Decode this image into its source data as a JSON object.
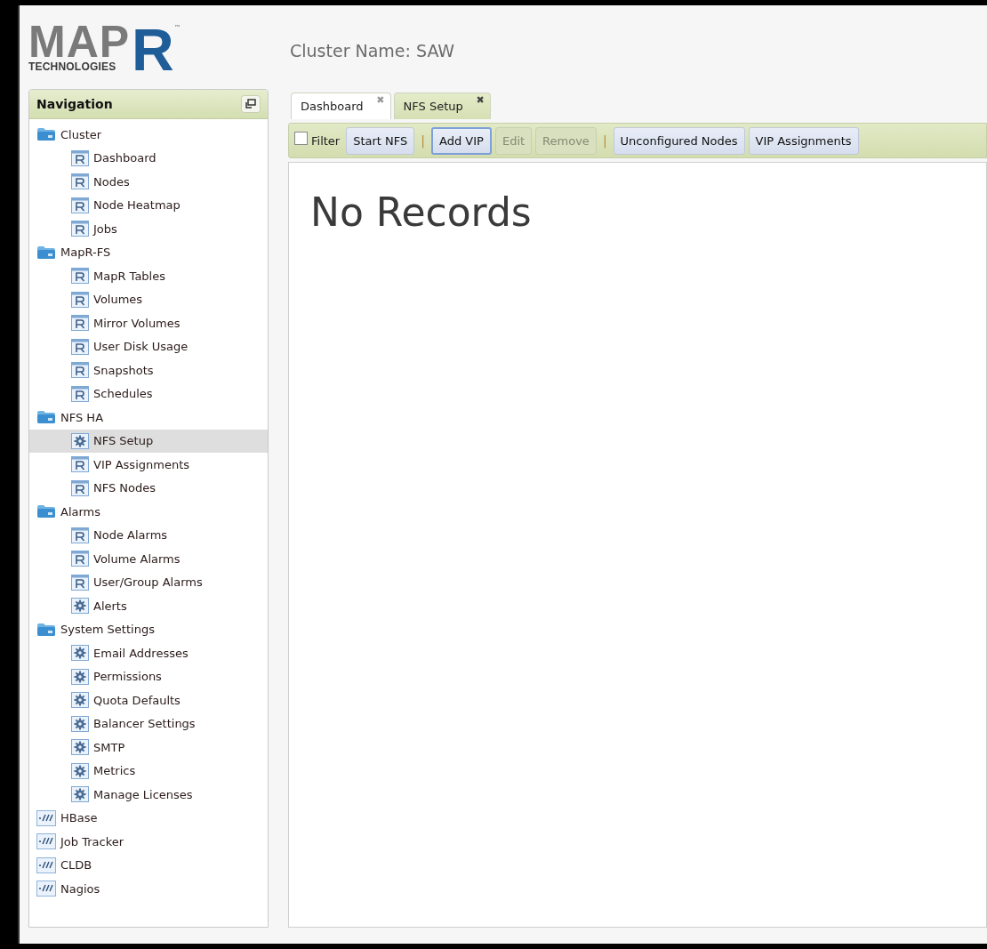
{
  "logo": {
    "word": "MAP",
    "letter": "R",
    "subtitle": "TECHNOLOGIES",
    "mark": "™"
  },
  "cluster_name": "Cluster Name: SAW",
  "navigation": {
    "title": "Navigation",
    "items": [
      {
        "label": "Cluster",
        "kind": "folder",
        "selected": false,
        "children": [
          {
            "label": "Dashboard",
            "kind": "report",
            "selected": false
          },
          {
            "label": "Nodes",
            "kind": "report",
            "selected": false
          },
          {
            "label": "Node Heatmap",
            "kind": "report",
            "selected": false
          },
          {
            "label": "Jobs",
            "kind": "report",
            "selected": false
          }
        ]
      },
      {
        "label": "MapR-FS",
        "kind": "folder",
        "selected": false,
        "children": [
          {
            "label": "MapR Tables",
            "kind": "report",
            "selected": false
          },
          {
            "label": "Volumes",
            "kind": "report",
            "selected": false
          },
          {
            "label": "Mirror Volumes",
            "kind": "report",
            "selected": false
          },
          {
            "label": "User Disk Usage",
            "kind": "report",
            "selected": false
          },
          {
            "label": "Snapshots",
            "kind": "report",
            "selected": false
          },
          {
            "label": "Schedules",
            "kind": "report",
            "selected": false
          }
        ]
      },
      {
        "label": "NFS HA",
        "kind": "folder",
        "selected": false,
        "children": [
          {
            "label": "NFS Setup",
            "kind": "settings",
            "selected": true
          },
          {
            "label": "VIP Assignments",
            "kind": "report",
            "selected": false
          },
          {
            "label": "NFS Nodes",
            "kind": "report",
            "selected": false
          }
        ]
      },
      {
        "label": "Alarms",
        "kind": "folder",
        "selected": false,
        "children": [
          {
            "label": "Node Alarms",
            "kind": "report",
            "selected": false
          },
          {
            "label": "Volume Alarms",
            "kind": "report",
            "selected": false
          },
          {
            "label": "User/Group Alarms",
            "kind": "report",
            "selected": false
          },
          {
            "label": "Alerts",
            "kind": "settings",
            "selected": false
          }
        ]
      },
      {
        "label": "System Settings",
        "kind": "folder",
        "selected": false,
        "children": [
          {
            "label": "Email Addresses",
            "kind": "settings",
            "selected": false
          },
          {
            "label": "Permissions",
            "kind": "settings",
            "selected": false
          },
          {
            "label": "Quota Defaults",
            "kind": "settings",
            "selected": false
          },
          {
            "label": "Balancer Settings",
            "kind": "settings",
            "selected": false
          },
          {
            "label": "SMTP",
            "kind": "settings",
            "selected": false
          },
          {
            "label": "Metrics",
            "kind": "settings",
            "selected": false
          },
          {
            "label": "Manage Licenses",
            "kind": "settings",
            "selected": false
          }
        ]
      },
      {
        "label": "HBase",
        "kind": "monitor",
        "selected": false
      },
      {
        "label": "Job Tracker",
        "kind": "monitor",
        "selected": false
      },
      {
        "label": "CLDB",
        "kind": "monitor",
        "selected": false
      },
      {
        "label": "Nagios",
        "kind": "monitor",
        "selected": false
      }
    ]
  },
  "tabs": [
    {
      "label": "Dashboard",
      "selected": false,
      "close": "✖"
    },
    {
      "label": "NFS Setup",
      "selected": true,
      "close": "✖"
    }
  ],
  "toolbar": [
    {
      "kind": "checkbox",
      "label": "Filter",
      "checked": false
    },
    {
      "kind": "button",
      "label": "Start NFS",
      "disabled": false,
      "focused": false
    },
    {
      "kind": "separator",
      "label": "|"
    },
    {
      "kind": "button",
      "label": "Add VIP",
      "disabled": false,
      "focused": true
    },
    {
      "kind": "button",
      "label": "Edit",
      "disabled": true,
      "focused": false
    },
    {
      "kind": "button",
      "label": "Remove",
      "disabled": true,
      "focused": false
    },
    {
      "kind": "separator",
      "label": "|"
    },
    {
      "kind": "button",
      "label": "Unconfigured Nodes",
      "disabled": false,
      "focused": false
    },
    {
      "kind": "button",
      "label": "VIP Assignments",
      "disabled": false,
      "focused": false
    }
  ],
  "content": {
    "message": "No Records"
  }
}
